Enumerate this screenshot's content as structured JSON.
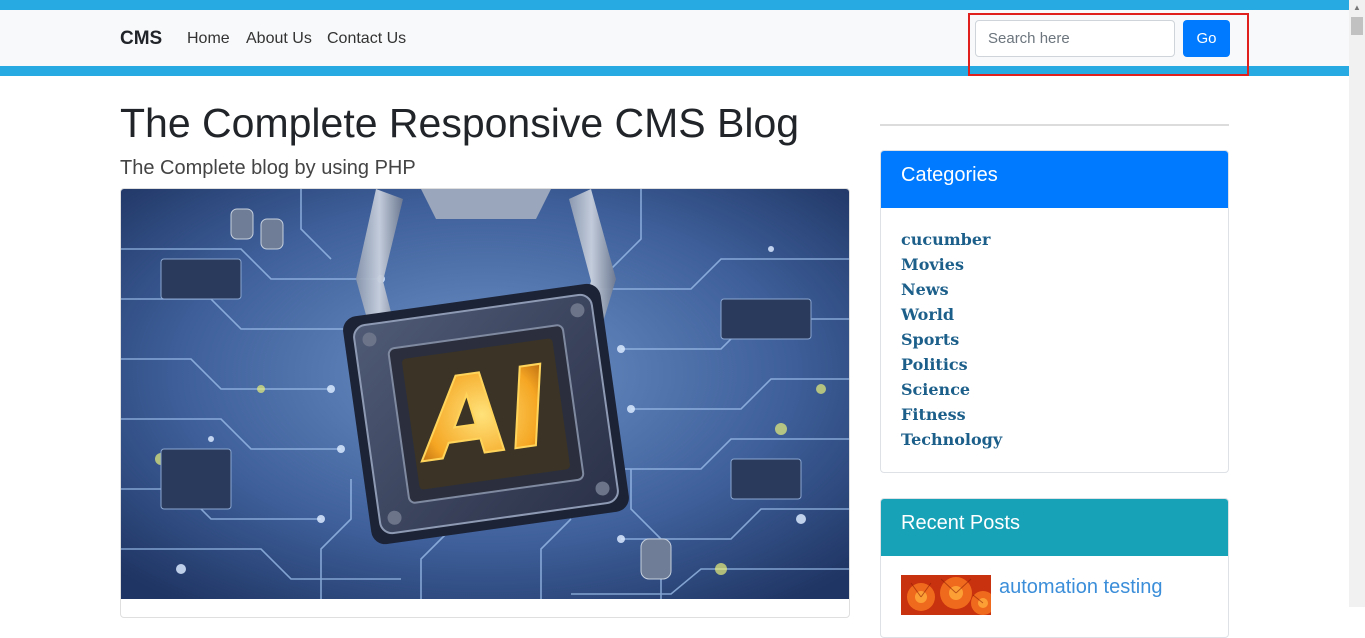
{
  "nav": {
    "brand": "CMS",
    "links": [
      "Home",
      "About Us",
      "Contact Us"
    ],
    "search_placeholder": "Search here",
    "search_button": "Go"
  },
  "main": {
    "title": "The Complete Responsive CMS Blog",
    "subtitle": "The Complete blog by using PHP",
    "image_icon": "ai-chip-image",
    "image_text": "AI"
  },
  "sidebar": {
    "categories": {
      "title": "Categories",
      "items": [
        "cucumber",
        "Movies",
        "News",
        "World",
        "Sports",
        "Politics",
        "Science",
        "Fitness",
        "Technology"
      ]
    },
    "recent": {
      "title": "Recent Posts",
      "items": [
        {
          "title": "automation testing",
          "thumb_icon": "flower-thumbnail"
        }
      ]
    }
  },
  "colors": {
    "accent_bar": "#27aae1",
    "primary": "#007bff",
    "info": "#17a2b8",
    "highlight_box": "#e0201c"
  }
}
